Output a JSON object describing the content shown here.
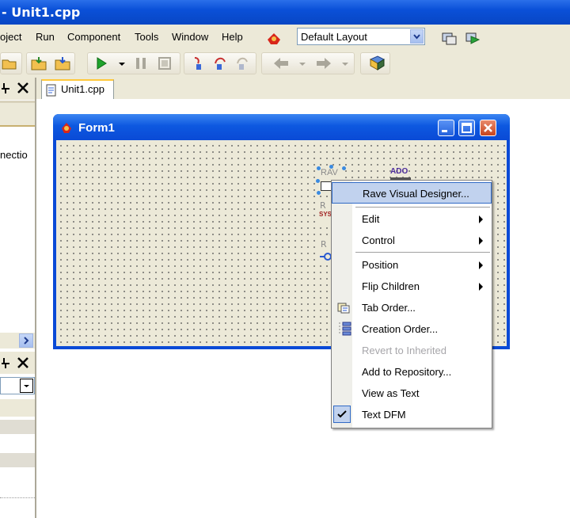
{
  "window": {
    "title": "- Unit1.cpp"
  },
  "menubar": {
    "items": [
      "oject",
      "Run",
      "Component",
      "Tools",
      "Window",
      "Help"
    ]
  },
  "layout_combo": {
    "value": "Default Layout"
  },
  "tabs": {
    "active": "Unit1.cpp"
  },
  "left_panel": {
    "connection_text": "nectio"
  },
  "form": {
    "title": "Form1"
  },
  "components": {
    "ado_label": "ADO",
    "rave_label": "RAV",
    "sys_label": "SYS"
  },
  "context_menu": {
    "items": [
      {
        "label": "Rave Visual Designer...",
        "highlighted": true
      },
      {
        "label": "Edit",
        "submenu": true
      },
      {
        "label": "Control",
        "submenu": true
      },
      {
        "label": "Position",
        "submenu": true
      },
      {
        "label": "Flip Children",
        "submenu": true
      },
      {
        "label": "Tab Order...",
        "icon": "tab-order-icon"
      },
      {
        "label": "Creation Order...",
        "icon": "creation-order-icon"
      },
      {
        "label": "Revert to Inherited",
        "disabled": true
      },
      {
        "label": "Add to Repository..."
      },
      {
        "label": "View as Text"
      },
      {
        "label": "Text DFM",
        "checked": true
      }
    ]
  },
  "colors": {
    "titlebar": "#0a50d8",
    "menu_highlight": "#c1d2ee",
    "disabled_text": "#a7a6aa"
  }
}
